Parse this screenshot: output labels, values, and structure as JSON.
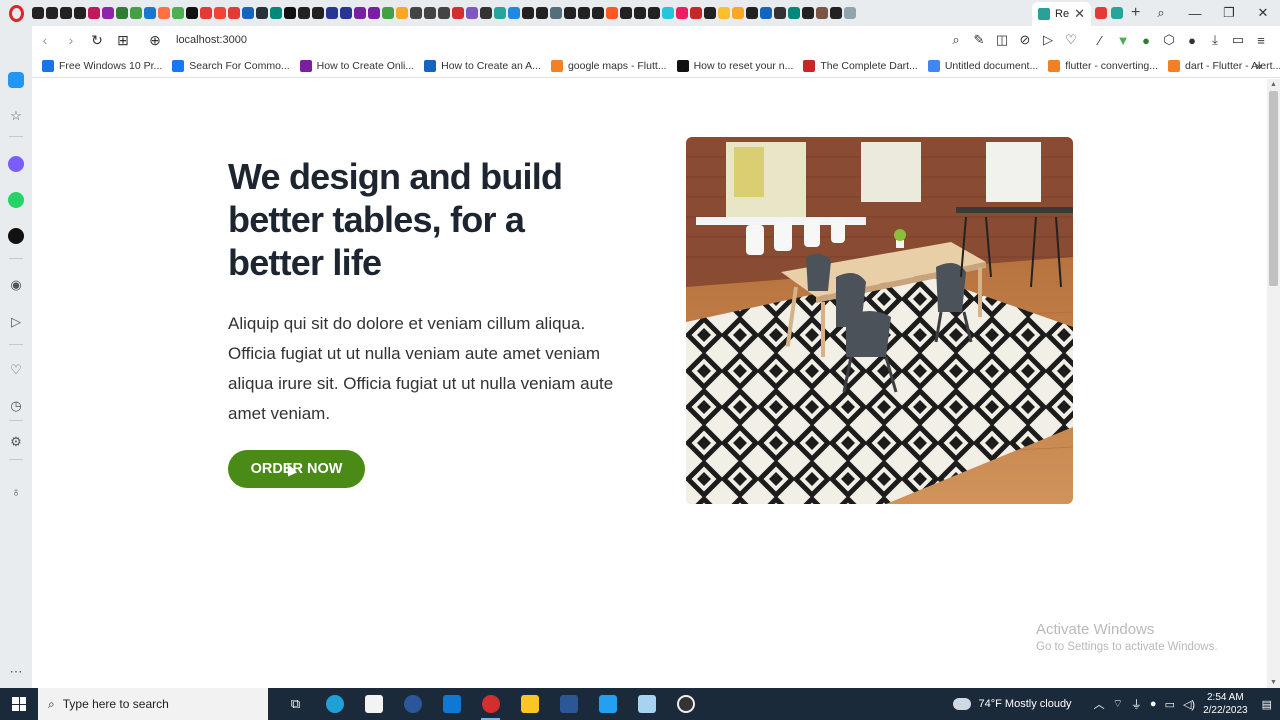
{
  "browser": {
    "active_tab_title": "Re",
    "url": "localhost:3000",
    "bookmarks": [
      {
        "label": "Free Windows 10 Pr...",
        "color": "#1a73e8"
      },
      {
        "label": "Search For Commo...",
        "color": "#1877f2"
      },
      {
        "label": "How to Create Onli...",
        "color": "#7b1fa2"
      },
      {
        "label": "How to Create an A...",
        "color": "#1565c0"
      },
      {
        "label": "google maps - Flutt...",
        "color": "#f48024"
      },
      {
        "label": "How to reset your n...",
        "color": "#111111"
      },
      {
        "label": "The Complete Dart...",
        "color": "#c62828"
      },
      {
        "label": "Untitled document...",
        "color": "#4285f4"
      },
      {
        "label": "flutter - converting...",
        "color": "#f48024"
      },
      {
        "label": "dart - Flutter - Alert...",
        "color": "#f48024"
      }
    ]
  },
  "hero": {
    "title": "We design and build better tables, for a better life",
    "description": "Aliquip qui sit do dolore et veniam cillum aliqua. Officia fugiat ut ut nulla veniam aute amet veniam aliqua irure sit. Officia fugiat ut ut nulla veniam aute amet veniam.",
    "cta_label": "ORDER NOW",
    "cta_color": "#4a8a16",
    "title_color": "#1d2530"
  },
  "watermark": {
    "line1": "Activate Windows",
    "line2": "Go to Settings to activate Windows."
  },
  "taskbar": {
    "search_placeholder": "Type here to search",
    "weather": "74°F  Mostly cloudy",
    "time": "2:54 AM",
    "date": "2/22/2023"
  }
}
